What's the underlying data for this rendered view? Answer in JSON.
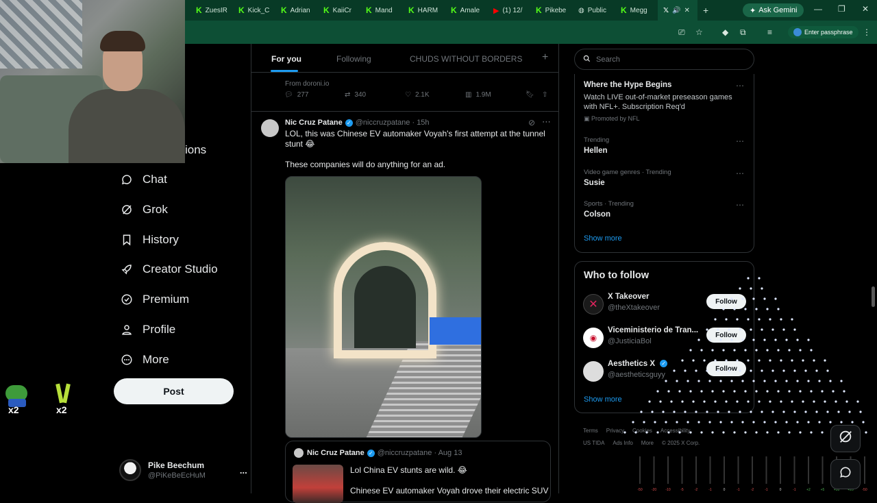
{
  "browser": {
    "tabs": [
      {
        "label": "ZuesIR",
        "icon": "kick-icon"
      },
      {
        "label": "Kick_C",
        "icon": "kick-icon"
      },
      {
        "label": "Adrian",
        "icon": "kick-icon"
      },
      {
        "label": "KaiiCr",
        "icon": "kick-icon"
      },
      {
        "label": "Mand",
        "icon": "kick-icon"
      },
      {
        "label": "HARM",
        "icon": "kick-icon"
      },
      {
        "label": "Amale",
        "icon": "kick-icon"
      },
      {
        "label": "(1) 12/",
        "icon": "youtube-icon"
      },
      {
        "label": "Pikebe",
        "icon": "kick-icon"
      },
      {
        "label": "Public",
        "icon": "globe-icon"
      },
      {
        "label": "Megg",
        "icon": "kick-icon"
      }
    ],
    "ask_gemini": "Ask Gemini",
    "enter_passphrase": "Enter passphrase",
    "colors": {
      "tabbar": "#083a26",
      "accent": "#53fc18"
    }
  },
  "nav": {
    "partial_item": "ions",
    "items": [
      {
        "label": "Chat",
        "icon": "chat-icon"
      },
      {
        "label": "Grok",
        "icon": "grok-icon"
      },
      {
        "label": "History",
        "icon": "bookmark-icon"
      },
      {
        "label": "Creator Studio",
        "icon": "rocket-icon"
      },
      {
        "label": "Premium",
        "icon": "verified-badge-icon"
      },
      {
        "label": "Profile",
        "icon": "person-icon"
      },
      {
        "label": "More",
        "icon": "more-circle-icon"
      }
    ],
    "post_label": "Post",
    "emote_badges": [
      "x2",
      "x2"
    ]
  },
  "account": {
    "name": "Pike Beechum",
    "handle": "@PiKeBeEcHuM",
    "more": "..."
  },
  "timeline": {
    "tabs": [
      "For you",
      "Following",
      "CHUDS WITHOUT BORDERS"
    ],
    "add_tab": "+",
    "prev_tweet": {
      "source": "From doroni.io",
      "replies": "277",
      "reposts": "340",
      "likes": "2.1K",
      "views": "1.9M"
    },
    "tweet": {
      "name": "Nic Cruz Patane",
      "handle": "@niccruzpatane",
      "time": "· 15h",
      "text_line1": "LOL, this was Chinese EV automaker Voyah's first attempt at the tunnel",
      "text_line2": "stunt 😂",
      "text_line3": "These companies will do anything for an ad."
    },
    "quote": {
      "name": "Nic Cruz Patane",
      "handle": "@niccruzpatane",
      "time": "· Aug 13",
      "text_line1": "Lol China EV stunts are wild. 😂",
      "text_line2": "Chinese EV automaker Voyah drove their electric SUV"
    }
  },
  "sidebar": {
    "search_placeholder": "Search",
    "trends": [
      {
        "meta": "",
        "title": "Where the Hype Begins",
        "desc1": "Watch LIVE out-of-market preseason games",
        "desc2": "with NFL+. Subscription Req'd",
        "promoted": "Promoted by NFL"
      },
      {
        "meta": "Trending",
        "title": "Hellen"
      },
      {
        "meta": "Video game genres · Trending",
        "title": "Susie"
      },
      {
        "meta": "Sports · Trending",
        "title": "Colson"
      }
    ],
    "show_more": "Show more",
    "who_to_follow": {
      "title": "Who to follow",
      "accounts": [
        {
          "name": "X Takeover",
          "handle": "@theXtakeover",
          "button": "Follow"
        },
        {
          "name": "Viceministerio de Tran...",
          "handle": "@JusticiaBol",
          "button": "Follow"
        },
        {
          "name": "Aesthetics X",
          "handle": "@aestheticsguyy",
          "button": "Follow"
        }
      ],
      "show_more": "Show more"
    },
    "footer_line1": [
      "Terms",
      "Privacy",
      "Cookies",
      "Accessibility"
    ],
    "footer_line2": [
      "US TIDA",
      "Ads Info",
      "More",
      "© 2025 X Corp."
    ]
  },
  "mixer_labels": [
    "-50",
    "-20",
    "-10",
    "-5",
    "-2",
    "-1",
    "0",
    "-1",
    "-2",
    "-1",
    "0",
    "-1",
    "+2",
    "+5",
    "+10",
    "+20",
    "-50"
  ]
}
